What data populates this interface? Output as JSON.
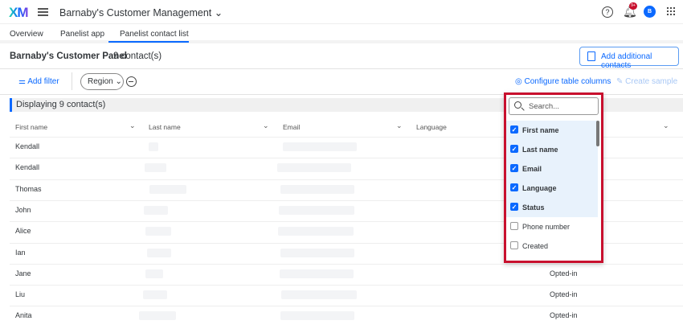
{
  "header": {
    "logo": "XM",
    "project": "Barnaby's Customer Management",
    "notif_badge": "9+",
    "avatar": "B"
  },
  "tabs": [
    "Overview",
    "Panelist app",
    "Panelist contact list"
  ],
  "panel": {
    "title": "Barnaby's Customer Panel",
    "count": "9 contact(s)",
    "add_contacts": "Add additional contacts"
  },
  "toolbar": {
    "add_filter": "Add filter",
    "region": "Region",
    "configure": "Configure table columns",
    "create_sample": "Create sample"
  },
  "table": {
    "displaying": "Displaying 9 contact(s)",
    "headers": [
      "First name",
      "Last name",
      "Email",
      "Language"
    ],
    "rows": [
      {
        "first": "Kendall"
      },
      {
        "first": "Kendall"
      },
      {
        "first": "Thomas"
      },
      {
        "first": "John"
      },
      {
        "first": "Alice"
      },
      {
        "first": "Ian"
      },
      {
        "first": "Jane",
        "status": "Opted-in"
      },
      {
        "first": "Liu",
        "status": "Opted-in"
      },
      {
        "first": "Anita",
        "status": "Opted-in"
      }
    ]
  },
  "columns_menu": {
    "search_placeholder": "Search...",
    "items": [
      {
        "label": "First name",
        "checked": true
      },
      {
        "label": "Last name",
        "checked": true
      },
      {
        "label": "Email",
        "checked": true
      },
      {
        "label": "Language",
        "checked": true
      },
      {
        "label": "Status",
        "checked": true
      },
      {
        "label": "Phone number",
        "checked": false
      },
      {
        "label": "Created",
        "checked": false
      }
    ]
  }
}
